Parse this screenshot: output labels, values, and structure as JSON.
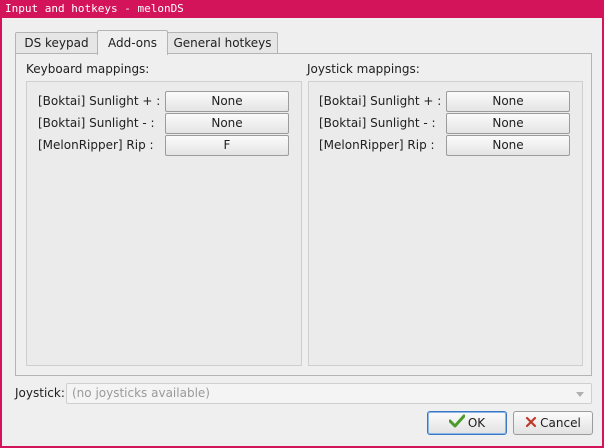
{
  "window": {
    "title": "Input and hotkeys - melonDS"
  },
  "tabs": [
    {
      "label": "DS keypad",
      "active": false
    },
    {
      "label": "Add-ons",
      "active": true
    },
    {
      "label": "General hotkeys",
      "active": false
    }
  ],
  "keyboard": {
    "heading": "Keyboard mappings:",
    "rows": [
      {
        "label": "[Boktai] Sunlight + :",
        "value": "None"
      },
      {
        "label": "[Boktai] Sunlight - :",
        "value": "None"
      },
      {
        "label": "[MelonRipper] Rip :",
        "value": "F"
      }
    ]
  },
  "joystick": {
    "heading": "Joystick mappings:",
    "rows": [
      {
        "label": "[Boktai] Sunlight + :",
        "value": "None"
      },
      {
        "label": "[Boktai] Sunlight - :",
        "value": "None"
      },
      {
        "label": "[MelonRipper] Rip :",
        "value": "None"
      }
    ]
  },
  "joystick_select": {
    "label": "Joystick:",
    "value": "(no joysticks available)"
  },
  "buttons": {
    "ok_label": "OK",
    "cancel_label": "Cancel"
  },
  "colors": {
    "titlebar": "#d4145a",
    "ok_icon": "#4a9a2c",
    "cancel_icon": "#c0392b"
  }
}
